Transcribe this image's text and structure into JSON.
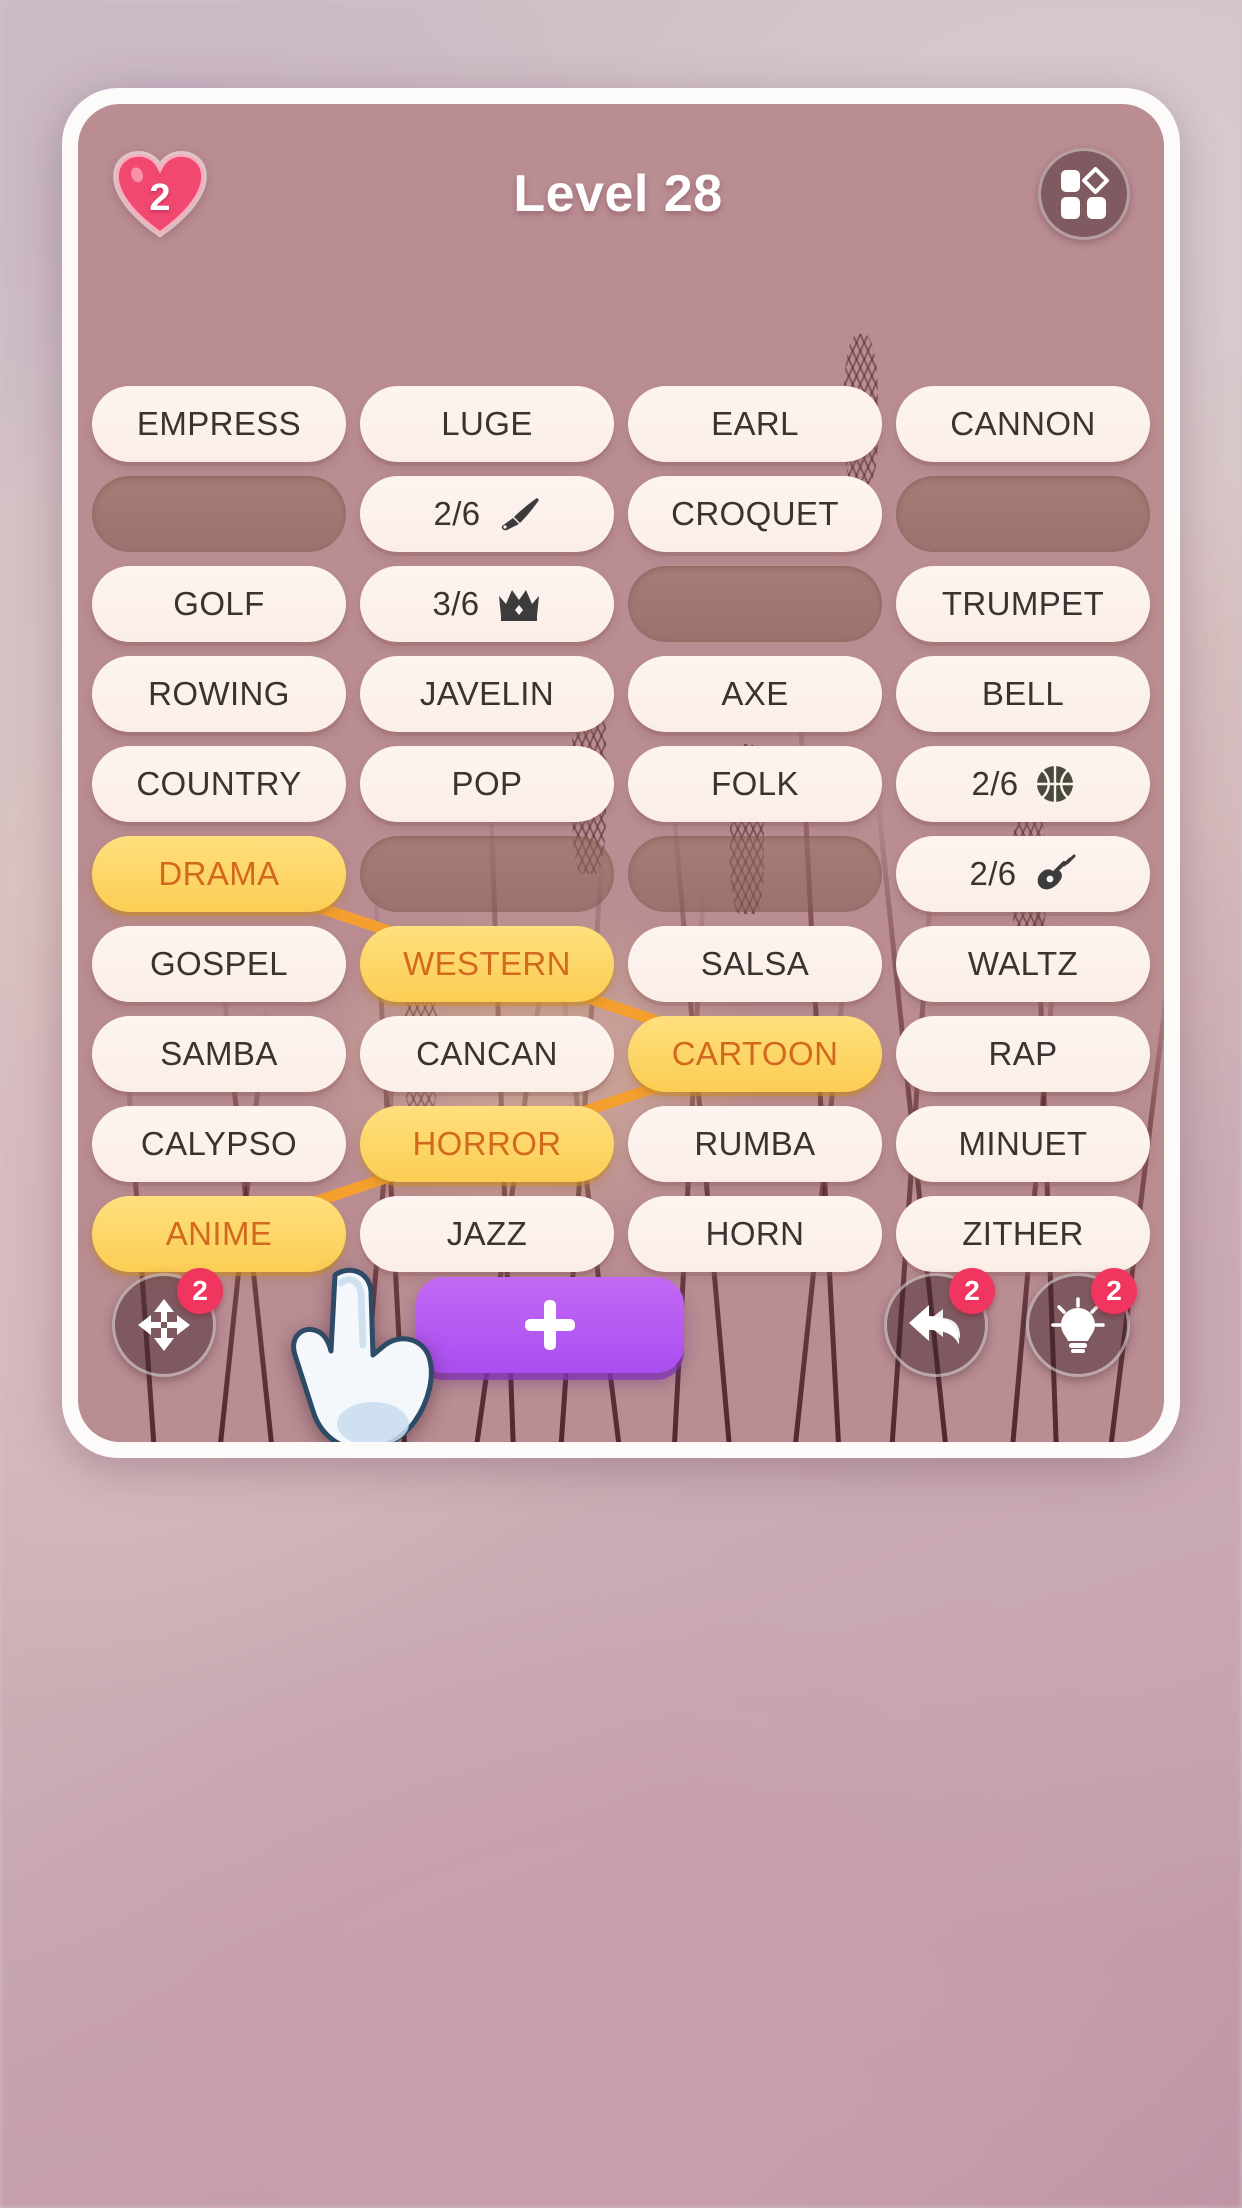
{
  "header": {
    "hearts_icon": "heart-icon",
    "hearts_count": "2",
    "title": "Level 28",
    "menu_icon": "grid-puzzle-icon"
  },
  "colors": {
    "tile_bg": "#fdf4f0",
    "tile_text": "#3a3330",
    "selected_bg": "#fbcd53",
    "selected_text": "#d2691e",
    "connector": "#f5a02e",
    "badge": "#f0365e",
    "add_button": "#a94ef0",
    "heart": "#f0486e"
  },
  "grid": {
    "columns": 4,
    "rows": [
      [
        {
          "type": "word",
          "label": "EMPRESS",
          "state": "normal"
        },
        {
          "type": "word",
          "label": "LUGE",
          "state": "normal"
        },
        {
          "type": "word",
          "label": "EARL",
          "state": "normal"
        },
        {
          "type": "word",
          "label": "CANNON",
          "state": "normal"
        }
      ],
      [
        {
          "type": "locked",
          "label": "",
          "state": "locked"
        },
        {
          "type": "hint",
          "label": "2/6",
          "icon": "knife-icon",
          "state": "normal"
        },
        {
          "type": "word",
          "label": "CROQUET",
          "state": "normal"
        },
        {
          "type": "locked",
          "label": "",
          "state": "locked"
        }
      ],
      [
        {
          "type": "word",
          "label": "GOLF",
          "state": "normal"
        },
        {
          "type": "hint",
          "label": "3/6",
          "icon": "crown-icon",
          "state": "normal"
        },
        {
          "type": "locked",
          "label": "",
          "state": "locked"
        },
        {
          "type": "word",
          "label": "TRUMPET",
          "state": "normal"
        }
      ],
      [
        {
          "type": "word",
          "label": "ROWING",
          "state": "normal"
        },
        {
          "type": "word",
          "label": "JAVELIN",
          "state": "normal"
        },
        {
          "type": "word",
          "label": "AXE",
          "state": "normal"
        },
        {
          "type": "word",
          "label": "BELL",
          "state": "normal"
        }
      ],
      [
        {
          "type": "word",
          "label": "COUNTRY",
          "state": "normal"
        },
        {
          "type": "word",
          "label": "POP",
          "state": "normal"
        },
        {
          "type": "word",
          "label": "FOLK",
          "state": "normal"
        },
        {
          "type": "hint",
          "label": "2/6",
          "icon": "basketball-icon",
          "state": "normal"
        }
      ],
      [
        {
          "type": "word",
          "label": "DRAMA",
          "state": "selected"
        },
        {
          "type": "locked",
          "label": "",
          "state": "locked"
        },
        {
          "type": "locked",
          "label": "",
          "state": "locked"
        },
        {
          "type": "hint",
          "label": "2/6",
          "icon": "guitar-icon",
          "state": "normal"
        }
      ],
      [
        {
          "type": "word",
          "label": "GOSPEL",
          "state": "normal"
        },
        {
          "type": "word",
          "label": "WESTERN",
          "state": "selected"
        },
        {
          "type": "word",
          "label": "SALSA",
          "state": "normal"
        },
        {
          "type": "word",
          "label": "WALTZ",
          "state": "normal"
        }
      ],
      [
        {
          "type": "word",
          "label": "SAMBA",
          "state": "normal"
        },
        {
          "type": "word",
          "label": "CANCAN",
          "state": "normal"
        },
        {
          "type": "word",
          "label": "CARTOON",
          "state": "selected"
        },
        {
          "type": "word",
          "label": "RAP",
          "state": "normal"
        }
      ],
      [
        {
          "type": "word",
          "label": "CALYPSO",
          "state": "normal"
        },
        {
          "type": "word",
          "label": "HORROR",
          "state": "selected"
        },
        {
          "type": "word",
          "label": "RUMBA",
          "state": "normal"
        },
        {
          "type": "word",
          "label": "MINUET",
          "state": "normal"
        }
      ],
      [
        {
          "type": "word",
          "label": "ANIME",
          "state": "selected"
        },
        {
          "type": "word",
          "label": "JAZZ",
          "state": "normal"
        },
        {
          "type": "word",
          "label": "HORN",
          "state": "normal"
        },
        {
          "type": "word",
          "label": "ZITHER",
          "state": "normal"
        }
      ]
    ],
    "selection_path": [
      "DRAMA",
      "WESTERN",
      "CARTOON",
      "HORROR",
      "ANIME"
    ]
  },
  "actions": {
    "shuffle": {
      "icon": "shuffle-arrows-icon",
      "count": "2"
    },
    "add": {
      "icon": "plus-icon",
      "label": "+"
    },
    "undo": {
      "icon": "undo-arrow-icon",
      "count": "2"
    },
    "hint": {
      "icon": "lightbulb-icon",
      "count": "2"
    }
  },
  "cursor": {
    "icon": "pointing-hand-icon"
  }
}
